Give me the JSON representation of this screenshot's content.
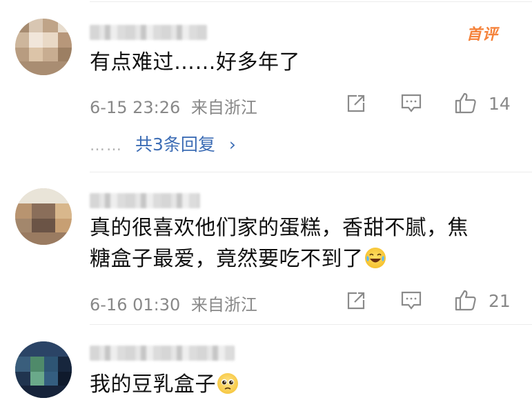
{
  "comments": [
    {
      "badge": "首评",
      "text": "有点难过……好多年了",
      "date": "6-15 23:26",
      "location": "来自浙江",
      "likes": "14",
      "replies_label": "共3条回复",
      "replies_dots": "……",
      "replies_chevron": "›"
    },
    {
      "text_line1": "真的很喜欢他们家的蛋糕，香甜不腻，焦",
      "text_line2": "糖盒子最爱，竟然要吃不到了",
      "emoji": "laughing-tears",
      "date": "6-16 01:30",
      "location": "来自浙江",
      "likes": "21"
    },
    {
      "text": "我的豆乳盒子",
      "emoji": "pleading-face"
    }
  ],
  "colors": {
    "badge": "#f5823a",
    "link": "#3d6db5",
    "meta": "#888888"
  }
}
